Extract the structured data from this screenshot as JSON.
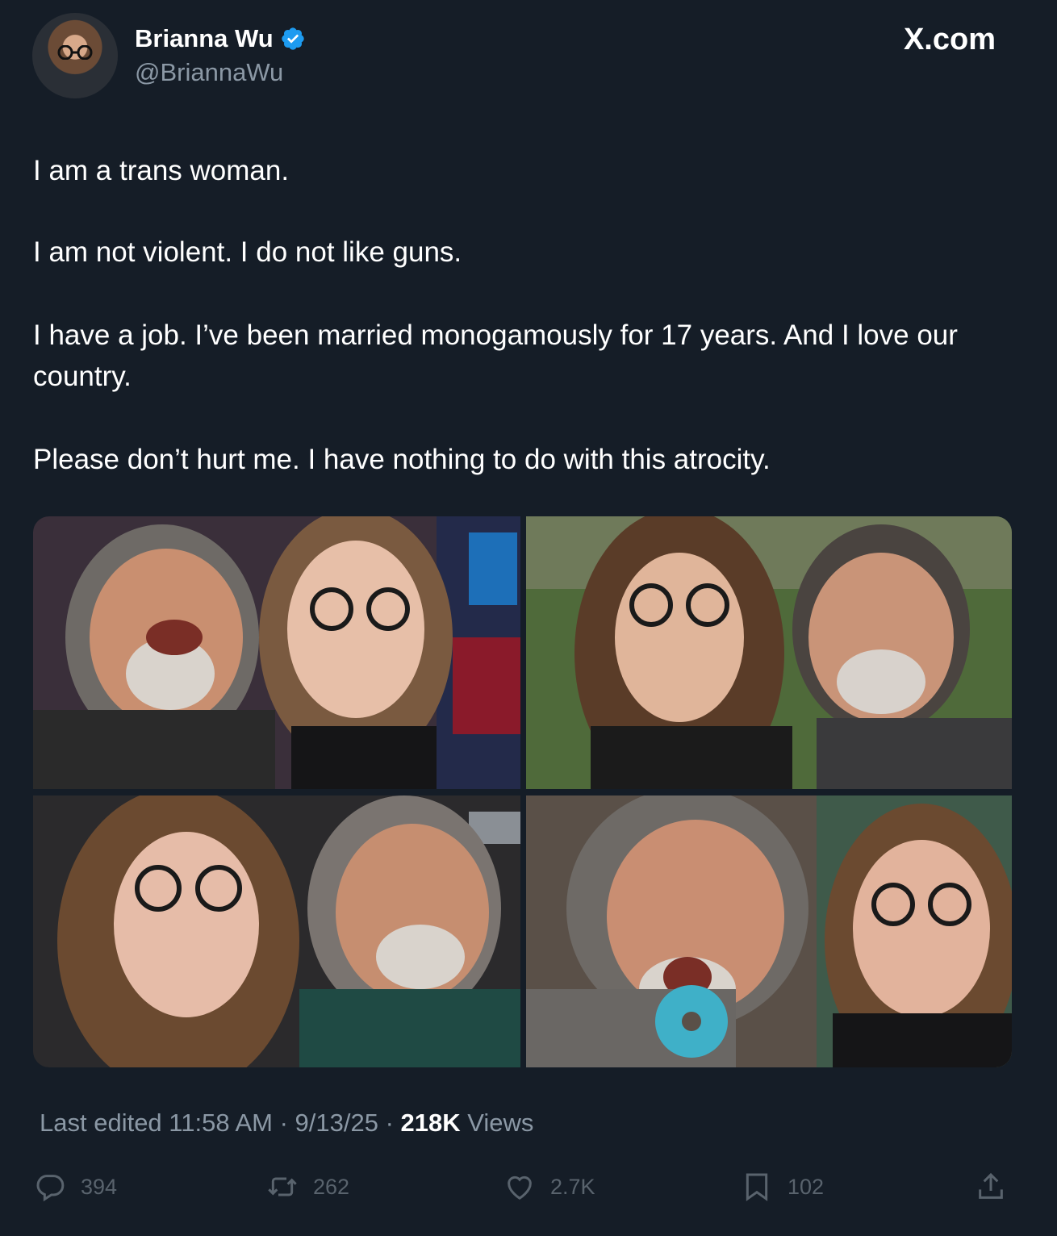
{
  "author": {
    "name": "Brianna Wu",
    "handle": "@BriannaWu",
    "verified": true
  },
  "site": "X.com",
  "tweet": {
    "paragraphs": [
      "I am a trans woman.",
      "I am not violent. I do not like guns.",
      "I have a job. I’ve been married monogamously for 17 years. And I love our country.",
      "Please don’t hurt me. I have nothing to do with this atrocity."
    ]
  },
  "meta": {
    "edited": "Last edited 11:58 AM",
    "separator": " · ",
    "date": "9/13/25",
    "separator2": " · ",
    "views_count": "218K",
    "views_label": " Views"
  },
  "actions": {
    "replies": "394",
    "reposts": "262",
    "likes": "2.7K",
    "bookmarks": "102"
  },
  "colors": {
    "background": "#151d27",
    "text": "#ffffff",
    "secondary": "#8b98a5",
    "verified": "#1d9bf0"
  }
}
